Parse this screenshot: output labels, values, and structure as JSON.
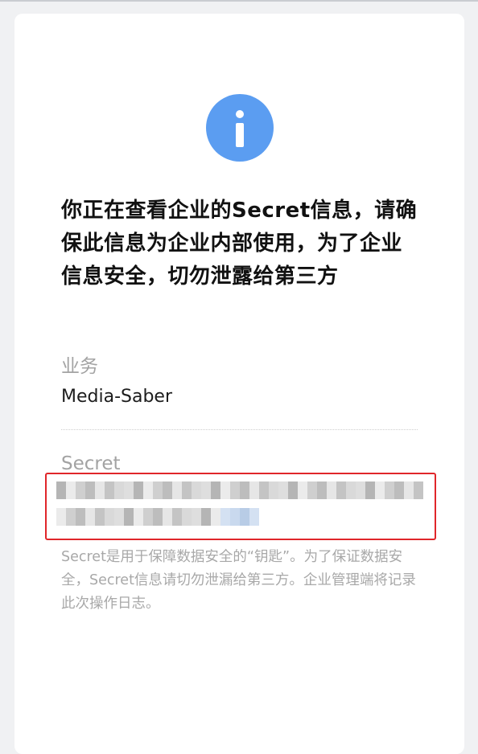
{
  "notice": {
    "icon": "info-icon",
    "accent_color": "#5b9df1",
    "headline": "你正在查看企业的Secret信息，请确保此信息为企业内部使用，为了企业信息安全，切勿泄露给第三方"
  },
  "business": {
    "label": "业务",
    "value": "Media-Saber"
  },
  "secret": {
    "label": "Secret",
    "value_state": "pixelated",
    "highlight_color": "#e0262a"
  },
  "note": {
    "text": "Secret是用于保障数据安全的“钥匙”。为了保证数据安全，Secret信息请切勿泄漏给第三方。企业管理端将记录此次操作日志。"
  }
}
